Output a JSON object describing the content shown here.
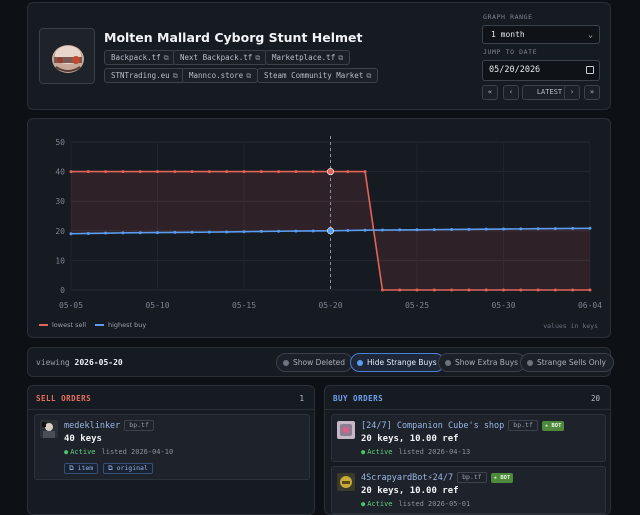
{
  "item": {
    "title": "Molten Mallard Cyborg Stunt Helmet",
    "links": [
      {
        "label": "Backpack.tf"
      },
      {
        "label": "Next Backpack.tf"
      },
      {
        "label": "Marketplace.tf"
      },
      {
        "label": "STNTrading.eu"
      },
      {
        "label": "Mannco.store"
      },
      {
        "label": "Steam Community Market"
      }
    ],
    "external_icon": "external-link-icon"
  },
  "controls": {
    "graph_range_label": "GRAPH RANGE",
    "graph_range_value": "1 month",
    "jump_label": "JUMP TO DATE",
    "jump_value": "05/20/2026",
    "nav": {
      "first": "«",
      "prev": "‹",
      "latest": "LATEST",
      "next": "›",
      "last": "»"
    }
  },
  "chart_data": {
    "type": "line",
    "x": [
      "2026-05-05",
      "2026-05-06",
      "2026-05-07",
      "2026-05-08",
      "2026-05-09",
      "2026-05-10",
      "2026-05-11",
      "2026-05-12",
      "2026-05-13",
      "2026-05-14",
      "2026-05-15",
      "2026-05-16",
      "2026-05-17",
      "2026-05-18",
      "2026-05-19",
      "2026-05-20",
      "2026-05-21",
      "2026-05-22",
      "2026-05-23",
      "2026-05-24",
      "2026-05-25",
      "2026-05-26",
      "2026-05-27",
      "2026-05-28",
      "2026-05-29",
      "2026-05-30",
      "2026-05-31",
      "2026-06-01",
      "2026-06-02",
      "2026-06-03",
      "2026-06-04"
    ],
    "x_tick_labels": [
      "05-05",
      "05-10",
      "05-15",
      "05-20",
      "05-25",
      "05-30",
      "06-04"
    ],
    "y_ticks": [
      0,
      10,
      20,
      30,
      40,
      50
    ],
    "ylim": [
      0,
      50
    ],
    "grid": true,
    "highlight_x": "2026-05-20",
    "series": [
      {
        "name": "lowest sell",
        "color": "#e06458",
        "values": [
          40,
          40,
          40,
          40,
          40,
          40,
          40,
          40,
          40,
          40,
          40,
          40,
          40,
          40,
          40,
          40,
          40,
          40,
          0,
          0,
          0,
          0,
          0,
          0,
          0,
          0,
          0,
          0,
          0,
          0,
          0
        ]
      },
      {
        "name": "highest buy",
        "color": "#5b9cf0",
        "values": [
          19.0,
          19.1,
          19.2,
          19.3,
          19.35,
          19.4,
          19.45,
          19.5,
          19.55,
          19.6,
          19.7,
          19.8,
          19.85,
          19.9,
          19.95,
          20.0,
          20.1,
          20.2,
          20.25,
          20.3,
          20.35,
          20.4,
          20.45,
          20.5,
          20.55,
          20.6,
          20.65,
          20.7,
          20.75,
          20.8,
          20.85
        ]
      }
    ],
    "units_note": "values in keys",
    "legend_position": "bottom-left"
  },
  "filters": {
    "viewing_label": "viewing",
    "viewing_date": "2026-05-20",
    "buttons": [
      {
        "label": "Show Deleted",
        "active": false
      },
      {
        "label": "Hide Strange Buys",
        "active": true
      },
      {
        "label": "Show Extra Buys",
        "active": false
      },
      {
        "label": "Strange Sells Only",
        "active": false
      }
    ]
  },
  "sell_orders": {
    "title": "SELL ORDERS",
    "count": "1",
    "color": "#e8705e",
    "items": [
      {
        "name": "medeklinker",
        "source": "bp.tf",
        "price": "40 keys",
        "status": "Active",
        "listed": "listed 2026-04-10",
        "links": [
          "item",
          "original"
        ]
      }
    ]
  },
  "buy_orders": {
    "title": "BUY ORDERS",
    "count": "20",
    "color": "#6fa3f0",
    "items": [
      {
        "name": "[24/7] Companion Cube's shop",
        "source": "bp.tf",
        "bot": "BOT",
        "price": "20 keys, 10.00 ref",
        "status": "Active",
        "listed": "listed 2026-04-13"
      },
      {
        "name": "4ScrapyardBot⚡24/7",
        "source": "bp.tf",
        "bot": "BOT",
        "price": "20 keys, 10.00 ref",
        "status": "Active",
        "listed": "listed 2026-05-01"
      }
    ]
  }
}
